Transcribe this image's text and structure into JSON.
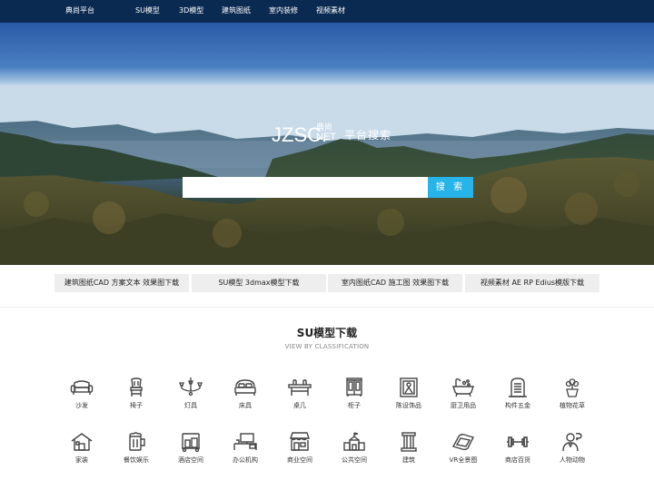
{
  "nav": {
    "brand": "典尚平台",
    "items": [
      "SU模型",
      "3D模型",
      "建筑图纸",
      "室内装修",
      "视频素材"
    ]
  },
  "hero": {
    "logo_main": "JZSC.",
    "logo_cn": "典尚",
    "logo_net": "NET",
    "logo_tagline": "平台搜索",
    "search_placeholder": "",
    "search_button": "搜 索"
  },
  "categories": [
    "建筑图纸CAD 方案文本 效果图下载",
    "SU模型 3dmax模型下载",
    "室内图纸CAD 施工图 效果图下载",
    "视频素材 AE RP Edius模版下载"
  ],
  "section": {
    "title": "SU模型下载",
    "subtitle": "VIEW BY CLASSIFICATION"
  },
  "icons_row1": [
    {
      "label": "沙发",
      "icon": "sofa-icon"
    },
    {
      "label": "椅子",
      "icon": "chair-icon"
    },
    {
      "label": "灯具",
      "icon": "chandelier-icon"
    },
    {
      "label": "床具",
      "icon": "bed-icon"
    },
    {
      "label": "桌几",
      "icon": "table-icon"
    },
    {
      "label": "柜子",
      "icon": "cabinet-icon"
    },
    {
      "label": "陈设饰品",
      "icon": "picture-frame-icon"
    },
    {
      "label": "厨卫用品",
      "icon": "bathtub-icon"
    },
    {
      "label": "构件五金",
      "icon": "door-icon"
    },
    {
      "label": "植物花草",
      "icon": "potted-plant-icon"
    }
  ],
  "icons_row2": [
    {
      "label": "家装",
      "icon": "house-icon"
    },
    {
      "label": "餐饮娱乐",
      "icon": "beer-mug-icon"
    },
    {
      "label": "酒店空间",
      "icon": "luggage-cart-icon"
    },
    {
      "label": "办公机构",
      "icon": "office-desk-icon"
    },
    {
      "label": "商业空间",
      "icon": "storefront-icon"
    },
    {
      "label": "公共空间",
      "icon": "public-building-icon"
    },
    {
      "label": "建筑",
      "icon": "column-icon"
    },
    {
      "label": "VR全景图",
      "icon": "vr-headset-icon"
    },
    {
      "label": "商店百货",
      "icon": "dumbbell-icon"
    },
    {
      "label": "人物动物",
      "icon": "person-icon"
    }
  ],
  "colors": {
    "nav_bg": "#0b2a52",
    "search_button": "#27b4e9",
    "category_bg": "#eeeeee"
  }
}
